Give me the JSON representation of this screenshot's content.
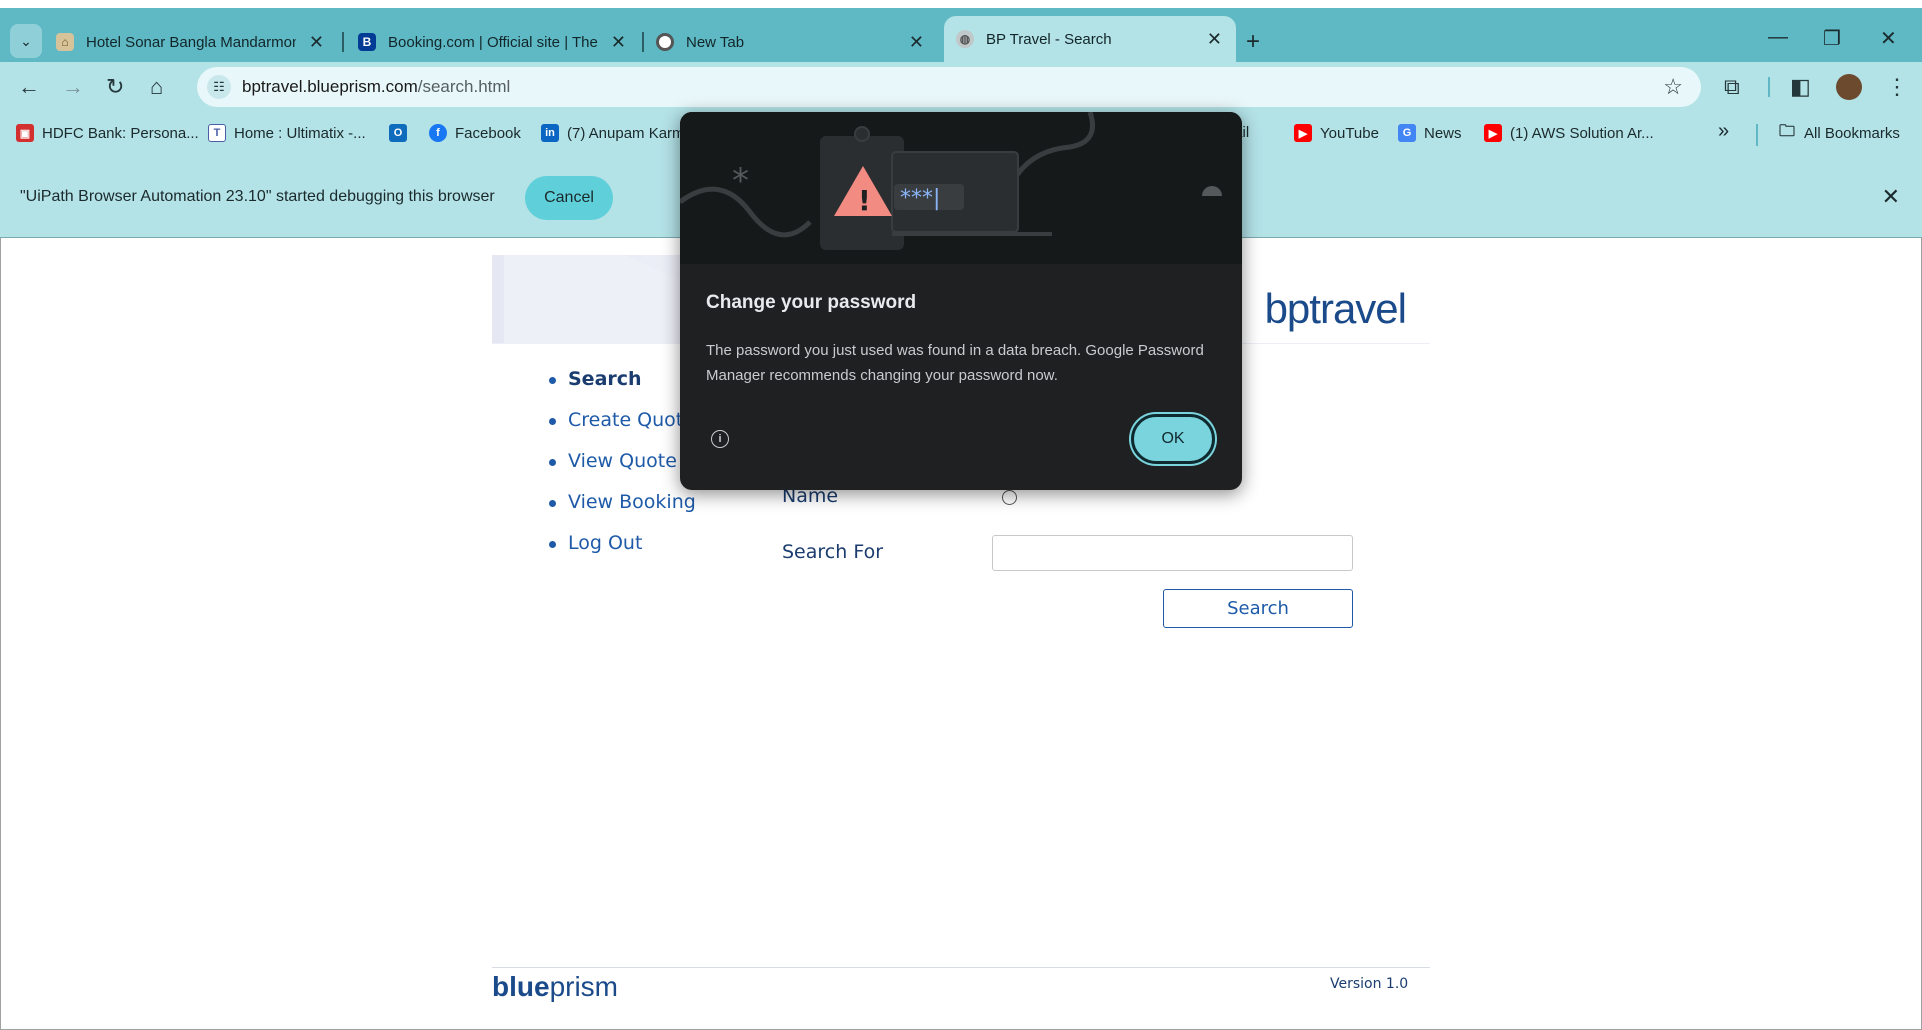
{
  "browser": {
    "tabs": [
      {
        "title": "Hotel Sonar Bangla Mandarmoni",
        "favicon": "hotel-icon"
      },
      {
        "title": "Booking.com | Official site | The",
        "favicon": "booking-icon"
      },
      {
        "title": "New Tab",
        "favicon": "chrome-icon"
      },
      {
        "title": "BP Travel - Search",
        "favicon": "globe-icon"
      }
    ],
    "address": {
      "domain": "bptravel.blueprism.com",
      "path": "/search.html"
    },
    "bookmarks": [
      {
        "label": "HDFC Bank: Persona...",
        "icon": "hdfc-icon",
        "color": "#d32f2f"
      },
      {
        "label": "Home : Ultimatix -...",
        "icon": "tata-icon",
        "color": "#4a5fa8"
      },
      {
        "label": "",
        "icon": "outlook-icon",
        "color": "#0f6cbd"
      },
      {
        "label": "Facebook",
        "icon": "facebook-icon",
        "color": "#1877f2"
      },
      {
        "label": "(7) Anupam Karm",
        "icon": "linkedin-icon",
        "color": "#0a66c2"
      },
      {
        "label": "Gmail",
        "icon": "gmail-icon",
        "color": "#c5221f"
      },
      {
        "label": "YouTube",
        "icon": "youtube-icon",
        "color": "#ff0000"
      },
      {
        "label": "News",
        "icon": "google-news-icon",
        "color": "#4285f4"
      },
      {
        "label": "(1) AWS Solution Ar...",
        "icon": "youtube-icon",
        "color": "#ff0000"
      }
    ],
    "bookmarks_overflow": "»",
    "all_bookmarks": "All Bookmarks"
  },
  "infobar": {
    "text": "\"UiPath Browser Automation 23.10\" started debugging this browser",
    "cancel": "Cancel"
  },
  "page": {
    "logo": "bptravel",
    "nav": [
      "Search",
      "Create Quote",
      "View Quote",
      "View Booking",
      "Log Out"
    ],
    "form": {
      "name_label": "Name",
      "search_for_label": "Search For",
      "search_value": "",
      "search_button": "Search"
    },
    "footer": {
      "logo_blue": "blue",
      "logo_prism": "prism",
      "version": "Version 1.0"
    }
  },
  "dialog": {
    "title": "Change your password",
    "body": "The password you just used was found in a data breach. Google Password Manager recommends changing your password now.",
    "ok": "OK"
  },
  "colors": {
    "tabstrip": "#5fb9c4",
    "toolbar": "#b3e2e7",
    "brand_blue": "#1e5aa8",
    "dialog_bg": "#1e2021",
    "ok_button": "#7ad4de"
  }
}
